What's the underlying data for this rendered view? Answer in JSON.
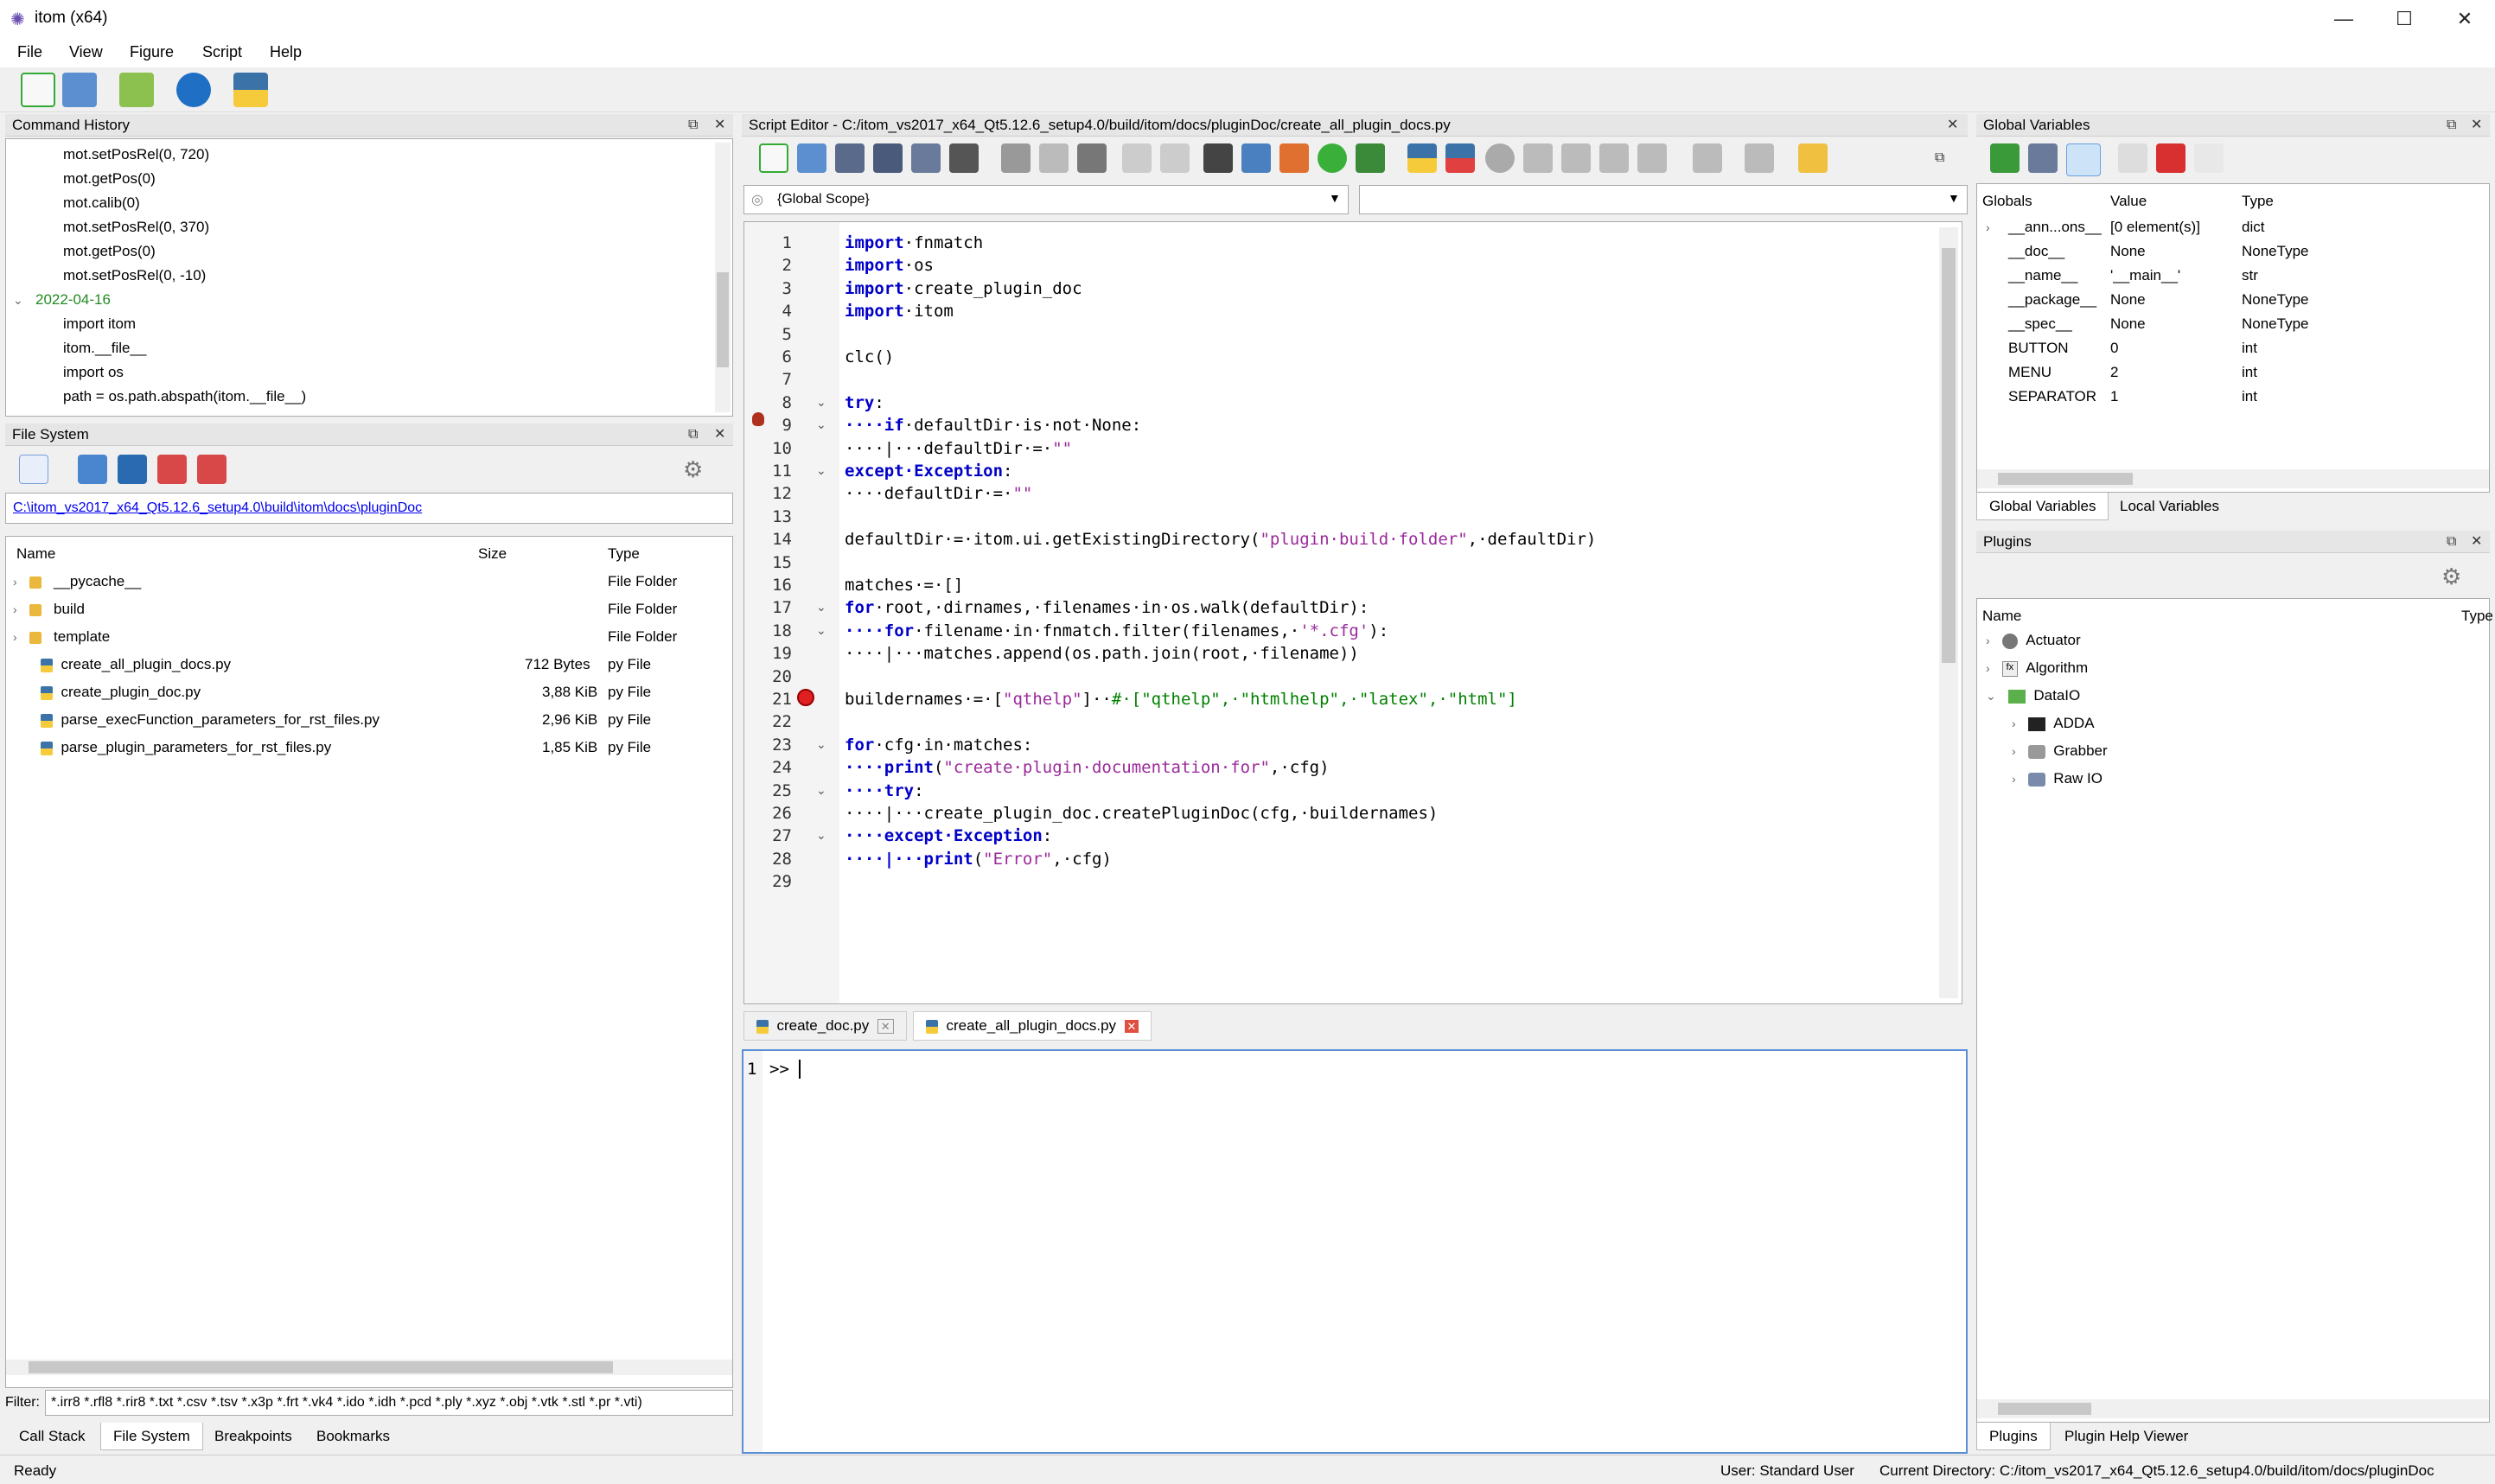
{
  "window": {
    "title": "itom (x64)",
    "min": "—",
    "max": "☐",
    "close": "✕"
  },
  "menu": [
    "File",
    "View",
    "Figure",
    "Script",
    "Help"
  ],
  "command_history": {
    "title": "Command History",
    "items": [
      {
        "text": "mot.setPosRel(0, 720)"
      },
      {
        "text": "mot.getPos(0)"
      },
      {
        "text": "mot.calib(0)"
      },
      {
        "text": "mot.setPosRel(0, 370)"
      },
      {
        "text": "mot.getPos(0)"
      },
      {
        "text": "mot.setPosRel(0, -10)"
      },
      {
        "text": "2022-04-16"
      },
      {
        "text": "import itom"
      },
      {
        "text": "itom.__file__"
      },
      {
        "text": "import os"
      },
      {
        "text": "path = os.path.abspath(itom.__file__)"
      }
    ]
  },
  "file_system": {
    "title": "File System",
    "path": "C:\\itom_vs2017_x64_Qt5.12.6_setup4.0\\build\\itom\\docs\\pluginDoc",
    "columns": {
      "name": "Name",
      "size": "Size",
      "type": "Type"
    },
    "rows": [
      {
        "name": "__pycache__",
        "size": "",
        "type": "File Folder"
      },
      {
        "name": "build",
        "size": "",
        "type": "File Folder"
      },
      {
        "name": "template",
        "size": "",
        "type": "File Folder"
      },
      {
        "name": "create_all_plugin_docs.py",
        "size": "712 Bytes",
        "type": "py File"
      },
      {
        "name": "create_plugin_doc.py",
        "size": "3,88 KiB",
        "type": "py File"
      },
      {
        "name": "parse_execFunction_parameters_for_rst_files.py",
        "size": "2,96 KiB",
        "type": "py File"
      },
      {
        "name": "parse_plugin_parameters_for_rst_files.py",
        "size": "1,85 KiB",
        "type": "py File"
      }
    ],
    "filter_label": "Filter:",
    "filter_value": "*.irr8 *.rfl8 *.rir8 *.txt *.csv *.tsv *.x3p *.frt *.vk4 *.ido *.idh *.pcd *.ply *.xyz *.obj *.vtk *.stl *.pr *.vti)"
  },
  "bottom_left_tabs": [
    "Call Stack",
    "File System",
    "Breakpoints",
    "Bookmarks"
  ],
  "script_editor": {
    "title": "Script Editor - C:/itom_vs2017_x64_Qt5.12.6_setup4.0/build/itom/docs/pluginDoc/create_all_plugin_docs.py",
    "scope": "{Global Scope}",
    "line_numbers": [
      "1",
      "2",
      "3",
      "4",
      "5",
      "6",
      "7",
      "8",
      "9",
      "10",
      "11",
      "12",
      "13",
      "14",
      "15",
      "16",
      "17",
      "18",
      "19",
      "20",
      "21",
      "22",
      "23",
      "24",
      "25",
      "26",
      "27",
      "28",
      "29"
    ],
    "code_lines": [
      [
        "import",
        "·fnmatch"
      ],
      [
        "import",
        "·os"
      ],
      [
        "import",
        "·create_plugin_doc"
      ],
      [
        "import",
        "·itom"
      ],
      [
        "",
        ""
      ],
      [
        "",
        "clc()"
      ],
      [
        "",
        ""
      ],
      [
        "try",
        ":"
      ],
      [
        "····if",
        "·defaultDir·is·not·None:"
      ],
      [
        "",
        "····|···defaultDir·=·\"\""
      ],
      [
        "except·Exception",
        ":"
      ],
      [
        "",
        "····defaultDir·=·\"\""
      ],
      [
        "",
        ""
      ],
      [
        "",
        "defaultDir·=·itom.ui.getExistingDirectory(\"plugin·build·folder\",·defaultDir)"
      ],
      [
        "",
        ""
      ],
      [
        "",
        "matches·=·[]"
      ],
      [
        "for",
        "·root,·dirnames,·filenames·in·os.walk(defaultDir):"
      ],
      [
        "····for",
        "·filename·in·fnmatch.filter(filenames,·'*.cfg'):"
      ],
      [
        "",
        "····|···matches.append(os.path.join(root,·filename))"
      ],
      [
        "",
        ""
      ],
      [
        "",
        "buildernames·=·[\"qthelp\"]··#·[\"qthelp\",·\"htmlhelp\",·\"latex\",·\"html\"]"
      ],
      [
        "",
        ""
      ],
      [
        "for",
        "·cfg·in·matches:"
      ],
      [
        "····print",
        "(\"create·plugin·documentation·for\",·cfg)"
      ],
      [
        "····try",
        ":"
      ],
      [
        "",
        "····|···create_plugin_doc.createPluginDoc(cfg,·buildernames)"
      ],
      [
        "····except·Exception",
        ":"
      ],
      [
        "····|···print",
        "(\"Error\",·cfg)"
      ],
      [
        "",
        ""
      ]
    ],
    "tabs": [
      "create_doc.py",
      "create_all_plugin_docs.py"
    ]
  },
  "console": {
    "line": "1",
    "prompt": ">>"
  },
  "global_variables": {
    "title": "Global Variables",
    "columns": {
      "name": "Globals",
      "value": "Value",
      "type": "Type"
    },
    "rows": [
      {
        "name": "__ann...ons__",
        "value": "[0 element(s)]",
        "type": "dict"
      },
      {
        "name": "__doc__",
        "value": "None",
        "type": "NoneType"
      },
      {
        "name": "__name__",
        "value": "'__main__'",
        "type": "str"
      },
      {
        "name": "__package__",
        "value": "None",
        "type": "NoneType"
      },
      {
        "name": "__spec__",
        "value": "None",
        "type": "NoneType"
      },
      {
        "name": "BUTTON",
        "value": "0",
        "type": "int"
      },
      {
        "name": "MENU",
        "value": "2",
        "type": "int"
      },
      {
        "name": "SEPARATOR",
        "value": "1",
        "type": "int"
      }
    ],
    "tabs": [
      "Global Variables",
      "Local Variables"
    ]
  },
  "plugins": {
    "title": "Plugins",
    "col_name": "Name",
    "col_type": "Type",
    "items": [
      {
        "name": "Actuator",
        "level": 0
      },
      {
        "name": "Algorithm",
        "level": 0
      },
      {
        "name": "DataIO",
        "level": 0
      },
      {
        "name": "ADDA",
        "level": 1
      },
      {
        "name": "Grabber",
        "level": 1
      },
      {
        "name": "Raw IO",
        "level": 1
      }
    ],
    "tabs": [
      "Plugins",
      "Plugin Help Viewer"
    ]
  },
  "status": {
    "ready": "Ready",
    "user": "User: Standard User",
    "cwd": "Current Directory: C:/itom_vs2017_x64_Qt5.12.6_setup4.0/build/itom/docs/pluginDoc"
  },
  "colors": {
    "keyword": "#0000c8",
    "string": "#9a2a9a",
    "comment": "#008000",
    "link": "#0000ee",
    "breakpoint": "#e02020"
  }
}
